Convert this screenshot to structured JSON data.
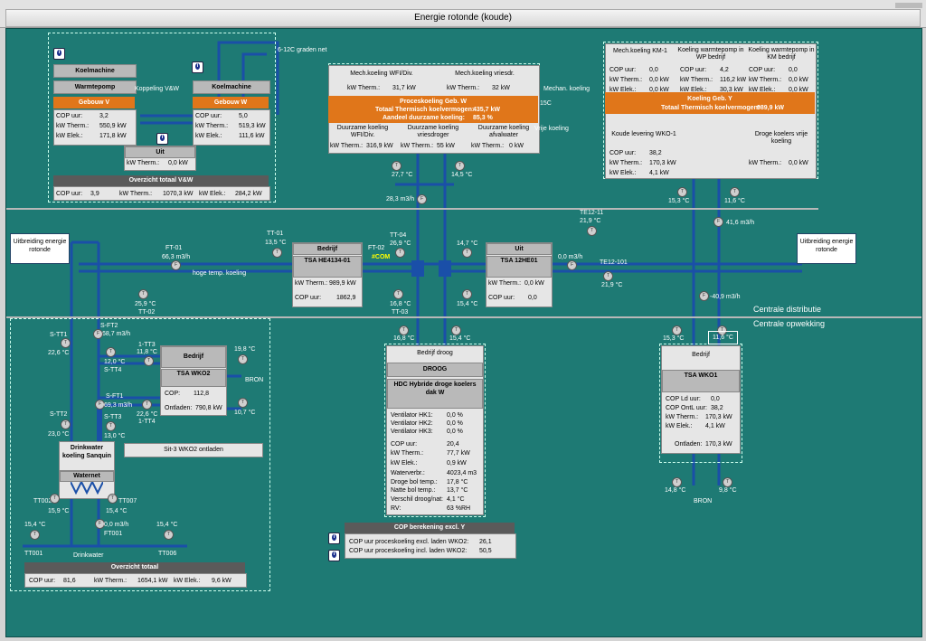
{
  "window_title": "Energie rotonde (koude)",
  "vw": {
    "koelmachine_left": "Koelmachine",
    "warmtepomp": "Warmtepomp",
    "gebouw_v": "Gebouw V",
    "cop_label": "COP uur:",
    "therm_label": "kW Therm.:",
    "elek_label": "kW Elek.:",
    "left_cop": "3,2",
    "left_therm": "550,9 kW",
    "left_elek": "171,8 kW",
    "koppeling": "Koppeling V&W",
    "koelmachine_right": "Koelmachine",
    "gebouw_w": "Gebouw W",
    "right_cop": "5,0",
    "right_therm": "519,3 kW",
    "right_elek": "111,6 kW",
    "uit_title": "Uit",
    "uit_therm": "0,0 kW",
    "overzicht_title": "Overzicht totaal V&W",
    "tot_cop": "3,9",
    "tot_therm": "1070,3 kW",
    "tot_elek": "284,2 kW"
  },
  "pipe_label_612c": "6-12C graden net",
  "proces": {
    "mech_wfi": "Mech.koeling WFI/Div.",
    "mech_vries": "Mech.koeling vriesdr.",
    "therm_label": "kW Therm.:",
    "mech_wfi_val": "31,7 kW",
    "mech_vries_val": "32 kW",
    "title": "Proceskoeling Geb. W",
    "totaal_label": "Totaal Thermisch koelvermogen:",
    "totaal_val": "435,7 kW",
    "aandeel_label": "Aandeel duurzame koeling:",
    "aandeel_val": "85,3 %",
    "dz_wfi": "Duurzame koeling WFI/Div.",
    "dz_vries": "Duurzame koeling vriesdroger",
    "dz_afval": "Duurzame koeling afvalwater",
    "dz_wfi_val": "316,9 kW",
    "dz_vries_val": "55 kW",
    "dz_afval_val": "0 kW",
    "mechan": "Mechan. koeling",
    "vrije": "Vrije koeling",
    "c15": "15C"
  },
  "gebY": {
    "km1": "Mech.koeling KM-1",
    "wp_wp": "Koeling warmtepomp in WP bedrijf",
    "wp_km": "Koeling warmtepomp in KM bedrijf",
    "cop_label": "COP uur:",
    "therm_label": "kW Therm.:",
    "elek_label": "kW Elek.:",
    "km1_cop": "0,0",
    "km1_therm": "0,0 kW",
    "km1_elek": "0,0 kW",
    "wp_cop": "4,2",
    "wp_therm": "116,2 kW",
    "wp_elek": "30,3 kW",
    "wk_cop": "0,0",
    "wk_therm": "0,0 kW",
    "wk_elek": "0,0 kW",
    "title": "Koeling Geb. Y",
    "totaal_label": "Totaal Thermisch koelvermogen:",
    "totaal_val": "989,9 kW",
    "wko1": "Koude levering WKO-1",
    "wko1_cop": "38,2",
    "wko1_therm": "170,3 kW",
    "wko1_elek": "4,1 kW",
    "droge": "Droge koelers vrije koeling",
    "droge_therm": "0,0 kW"
  },
  "sensors": {
    "t_277": "27,7 °C",
    "t_145": "14,5 °C",
    "flow_283": "28,3 m3/h",
    "t_153": "15,3 °C",
    "t_116": "11,6 °C",
    "flow_416": "41,6 m3/h",
    "te12_11": "TE12-11",
    "t_219": "21,9 °C",
    "te12_101": "TE12-101",
    "t_219b": "21,9 °C",
    "flow_00": "0,0 m3/h",
    "flow_m409": "-40,9 m3/h",
    "tt01": "TT-01",
    "t_135": "13,5 °C",
    "ft01": "FT-01",
    "flow_663": "66,3 m3/h",
    "hoge": "hoge temp. koeling",
    "t_259": "25,9 °C",
    "tt02": "TT-02",
    "tt04": "TT-04",
    "t_269": "26,9 °C",
    "ft02": "FT-02",
    "com": "#COM",
    "t_168": "16,8 °C",
    "tt03": "TT-03",
    "t_147": "14,7 °C",
    "t_154": "15,4 °C",
    "t_168b": "16,8 °C",
    "t_154b": "15,4 °C",
    "t_153b": "15,3 °C",
    "t_116b": "11,6 °C"
  },
  "tsa_he": {
    "bedrijf": "Bedrijf",
    "name": "TSA HE4134-01",
    "therm_label": "kW Therm.:",
    "therm": "989,9 kW",
    "cop_label": "COP uur:",
    "cop": "1862,9"
  },
  "tsa_12": {
    "uit": "Uit",
    "name": "TSA 12HE01",
    "therm_label": "kW Therm.:",
    "therm": "0,0 kW",
    "cop_label": "COP uur:",
    "cop": "0,0"
  },
  "uitbreiding_left": "Uitbreiding energie rotonde",
  "uitbreiding_right": "Uitbreiding energie rotonde",
  "centrale_distributie": "Centrale distributie",
  "centrale_opwekking": "Centrale opwekking",
  "wko2": {
    "stt1": "S-TT1",
    "t_226": "22,6 °C",
    "sft2": "S-FT2",
    "flow_687": "68,7 m3/h",
    "t_120": "12,0 °C",
    "stt4": "S-TT4",
    "tt3": "1-TT3",
    "t_118": "11,8 °C",
    "sft1": "S-FT1",
    "flow_693": "69,3 m3/h",
    "stt3": "S-TT3",
    "t_226b": "22,6 °C",
    "tt4": "1-TT4",
    "stt2": "S-TT2",
    "t_230": "23,0 °C",
    "t_130": "13,0 °C",
    "bedrijf": "Bedrijf",
    "name": "TSA WKO2",
    "cop_label": "COP:",
    "cop": "112,8",
    "ontladen_label": "Ontladen:",
    "ontladen": "790,8 kW",
    "t_198": "19,8 °C",
    "bron": "BRON",
    "t_107": "10,7 °C",
    "sit3": "Sit-3 WKO2 ontladen"
  },
  "drinkwater": {
    "title": "Drinkwater koeling Sanquin",
    "waternet": "Waternet",
    "tt002": "TT002",
    "t_159": "15,9 °C",
    "tt007": "TT007",
    "t_154": "15,4 °C",
    "ft001": "FT001",
    "flow_00": "0,0 m3/h",
    "t_154a": "15,4 °C",
    "t_154c": "15,4 °C",
    "tt001": "TT001",
    "tt006": "TT006",
    "drinkwater_label": "Drinkwater"
  },
  "overzicht": {
    "title": "Overzicht totaal",
    "cop_label": "COP uur:",
    "cop": "81,6",
    "therm_label": "kW Therm.:",
    "therm": "1654,1 kW",
    "elek_label": "kW Elek.:",
    "elek": "9,6 kW"
  },
  "droog": {
    "bedrijf": "Bedrijf droog",
    "droog": "DROOG",
    "hdc": "HDC Hybride droge koelers dak W",
    "hk1": "Ventilator HK1:",
    "hk2": "Ventilator HK2:",
    "hk3": "Ventilator HK3:",
    "hk1_val": "0,0 %",
    "hk2_val": "0,0 %",
    "hk3_val": "0,0 %",
    "cop_label": "COP uur:",
    "cop": "20,4",
    "therm_label": "kW Therm.:",
    "therm": "77,7 kW",
    "elek_label": "kW Elek.:",
    "elek": "0,9 kW",
    "water_label": "Waterverbr.:",
    "water": "4023,4 m3",
    "droge_label": "Droge bol temp.:",
    "droge": "17,8 °C",
    "natte_label": "Natte bol temp.:",
    "natte": "13,7 °C",
    "verschil_label": "Verschil droog/nat:",
    "verschil": "4,1 °C",
    "rv_label": "RV:",
    "rv": "63 %RH"
  },
  "copber": {
    "title": "COP berekening excl. Y",
    "l1": "COP uur proceskoeling excl. laden WKO2:",
    "v1": "26,1",
    "l2": "COP uur proceskoeling incl. laden WKO2:",
    "v2": "50,5"
  },
  "wko1": {
    "bedrijf": "Bedrijf",
    "name": "TSA WKO1",
    "ld_label": "COP Ld uur:",
    "ld": "0,0",
    "ontl_label": "COP OntL uur:",
    "ontl": "38,2",
    "therm_label": "kW Therm.:",
    "therm": "170,3 kW",
    "elek_label": "kW Elek.:",
    "elek": "4,1 kW",
    "ontladen_label": "Ontladen:",
    "ontladen": "170,3 kW",
    "t_148": "14,8 °C",
    "t_98": "9,8 °C",
    "bron": "BRON"
  },
  "colors": {
    "background": "#1e7a74",
    "pipe": "#1a4fa8",
    "orange": "#e0761a",
    "panel": "#e6e6e6"
  }
}
